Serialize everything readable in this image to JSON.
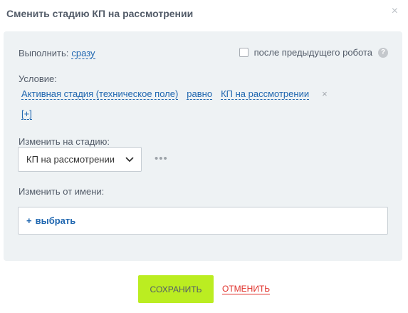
{
  "dialog": {
    "title": "Сменить стадию КП на рассмотрении",
    "close_glyph": "×"
  },
  "execute": {
    "label": "Выполнить:",
    "value": "сразу",
    "after_previous_label": "после предыдущего робота",
    "after_previous_checked": false,
    "help_glyph": "?"
  },
  "condition": {
    "label": "Условие:",
    "field": "Активная стадия (техническое поле)",
    "operator": "равно",
    "value": "КП на рассмотрении",
    "remove_glyph": "×",
    "add_label": "[+]"
  },
  "stage": {
    "label": "Изменить на стадию:",
    "selected": "КП на рассмотрении",
    "more_glyph": "•••"
  },
  "user": {
    "label": "Изменить от имени:",
    "plus": "+",
    "select_label": "выбрать"
  },
  "footer": {
    "save_label": "СОХРАНИТЬ",
    "cancel_label": "ОТМЕНИТЬ"
  },
  "colors": {
    "accent": "#2067b0",
    "save": "#bbed21",
    "cancel": "#e0312b",
    "panel": "#eef2f4"
  }
}
